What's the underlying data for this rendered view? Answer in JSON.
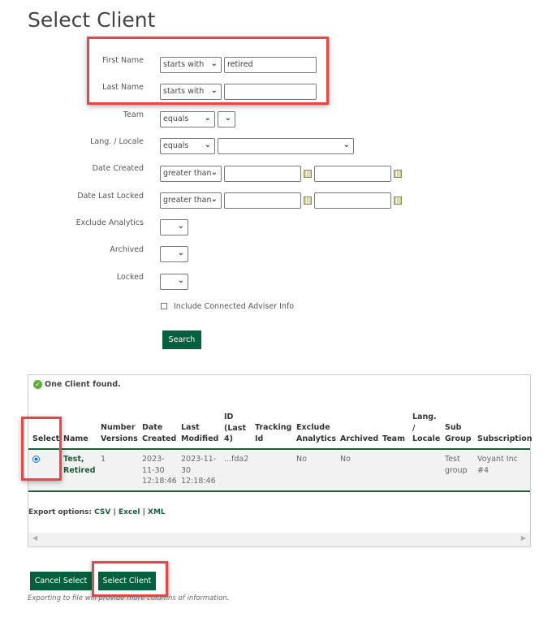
{
  "page_title": "Select Client",
  "filters": {
    "first_name": {
      "label": "First Name",
      "operator": "starts with",
      "value": "retired"
    },
    "last_name": {
      "label": "Last Name",
      "operator": "starts with",
      "value": ""
    },
    "team": {
      "label": "Team",
      "operator": "equals",
      "value": ""
    },
    "locale": {
      "label": "Lang. / Locale",
      "operator": "equals",
      "value": ""
    },
    "date_created": {
      "label": "Date Created",
      "operator": "greater than"
    },
    "date_locked": {
      "label": "Date Last Locked",
      "operator": "greater than"
    },
    "exclude_analytics": {
      "label": "Exclude Analytics"
    },
    "archived": {
      "label": "Archived"
    },
    "locked": {
      "label": "Locked"
    },
    "include_adviser": "Include Connected Adviser Info",
    "search": "Search"
  },
  "results": {
    "status": "One Client found.",
    "columns": [
      "Select",
      "Name",
      "Number Versions",
      "Date Created",
      "Last Modified",
      "ID (Last 4)",
      "Tracking Id",
      "Exclude Analytics",
      "Archived",
      "Team",
      "Lang. / Locale",
      "Sub Group",
      "Subscription"
    ],
    "row": {
      "name": "Test, Retired",
      "versions": "1",
      "created": "2023-11-30 12:18:46",
      "modified": "2023-11-30 12:18:46",
      "id": "...fda2",
      "tracking": "",
      "exclude": "No",
      "archived": "No",
      "team": "",
      "locale": "",
      "subgroup": "Test group",
      "subscription": "Voyant Inc #4"
    },
    "export_label": "Export options:",
    "export": [
      "CSV",
      "Excel",
      "XML"
    ]
  },
  "buttons": {
    "cancel": "Cancel Select",
    "select": "Select Client"
  },
  "note": "Exporting to file will provide more columns of information."
}
